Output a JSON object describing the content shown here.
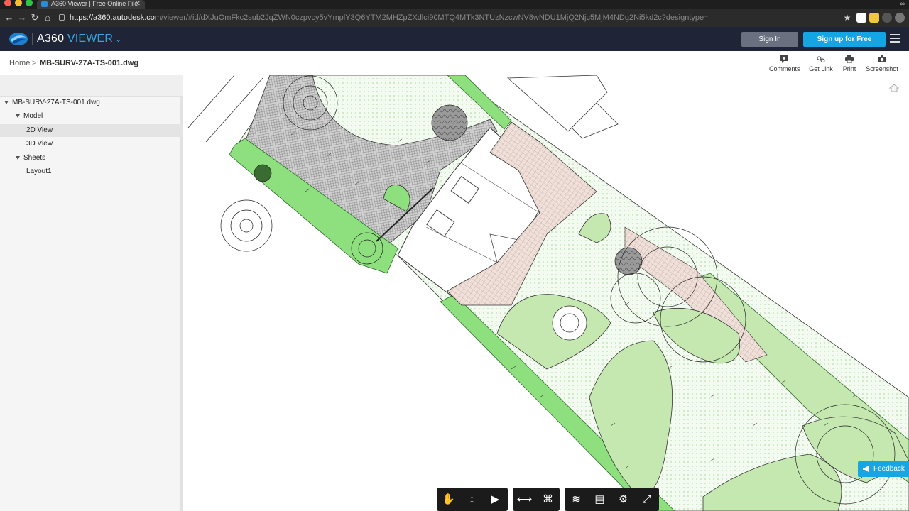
{
  "browser": {
    "tab_title": "A360 Viewer | Free Online File",
    "url_host": "https://a360.autodesk.com",
    "url_path": "/viewer/#id/dXJuOmFkc2sub2JqZWN0czpvcy5vYmplY3Q6YTM2MHZpZXdlci90MTQ4MTk3NTUzNzcwNV8wNDU1MjQ2Njc5MjM4NDg2Ni5kd2c?designtype="
  },
  "header": {
    "brand_a": "A360",
    "brand_b": "VIEWER",
    "sign_in": "Sign In",
    "sign_up": "Sign up for Free"
  },
  "breadcrumb": {
    "home": "Home",
    "separator": ">",
    "file": "MB-SURV-27A-TS-001.dwg"
  },
  "tools": {
    "comments": "Comments",
    "get_link": "Get Link",
    "print": "Print",
    "screenshot": "Screenshot"
  },
  "tree": {
    "root": "MB-SURV-27A-TS-001.dwg",
    "model": "Model",
    "view_2d": "2D View",
    "view_3d": "3D View",
    "sheets": "Sheets",
    "layout1": "Layout1"
  },
  "feedback": "Feedback",
  "colors": {
    "header_bg": "#1f2536",
    "accent": "#14a5e5",
    "lawn_green": "#8ee07e",
    "plant_green": "#c4e8b0",
    "paving": "#e8d6d0"
  }
}
